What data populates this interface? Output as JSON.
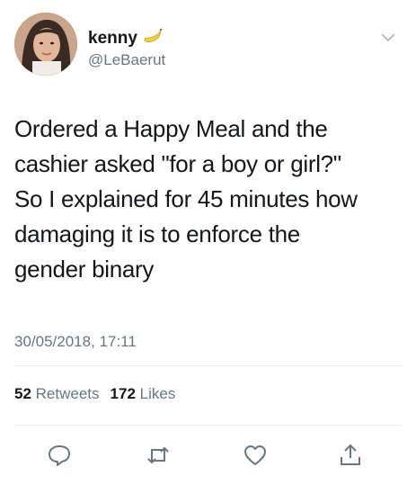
{
  "user": {
    "display_name": "kenny",
    "handle": "@LeBaerut",
    "avatar_icon": "avatar-photo",
    "badge_icon": "banana-icon"
  },
  "tweet": {
    "lines": [
      "Ordered a Happy Meal and the",
      "cashier asked \"for a boy or girl?\"",
      "So I explained for 45 minutes how",
      "damaging it is to enforce the",
      "gender binary"
    ],
    "timestamp": "30/05/2018, 17:11"
  },
  "stats": {
    "retweets_count": "52",
    "retweets_label": "Retweets",
    "likes_count": "172",
    "likes_label": "Likes"
  },
  "actions": {
    "icons": [
      "reply-icon",
      "retweet-icon",
      "like-icon",
      "share-icon"
    ]
  },
  "colors": {
    "text": "#14171a",
    "secondary": "#657786",
    "divider": "#e6ecf0",
    "icon": "#657786"
  }
}
